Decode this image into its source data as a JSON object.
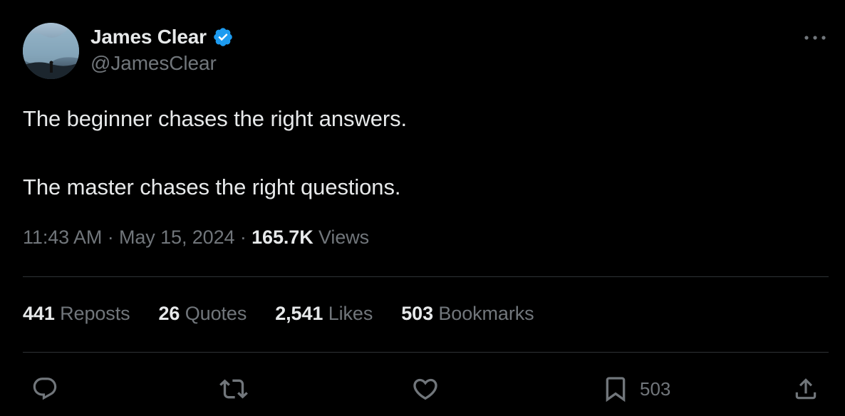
{
  "author": {
    "display_name": "James Clear",
    "handle": "@JamesClear",
    "verified": true
  },
  "tweet": {
    "lines": [
      "The beginner chases the right answers.",
      "The master chases the right questions."
    ],
    "time": "11:43 AM",
    "separator": "·",
    "date": "May 15, 2024",
    "views_count": "165.7K",
    "views_label": "Views"
  },
  "stats": [
    {
      "count": "441",
      "label": "Reposts"
    },
    {
      "count": "26",
      "label": "Quotes"
    },
    {
      "count": "2,541",
      "label": "Likes"
    },
    {
      "count": "503",
      "label": "Bookmarks"
    }
  ],
  "actions": {
    "bookmark_count": "503"
  },
  "icons": {
    "more": "more-horizontal-icon",
    "verified": "verified-badge-icon",
    "reply": "reply-icon",
    "repost": "repost-icon",
    "like": "heart-icon",
    "bookmark": "bookmark-icon",
    "share": "share-icon"
  },
  "colors": {
    "background": "#000000",
    "text_primary": "#e7e9ea",
    "text_secondary": "#71767b",
    "verified_blue": "#1d9bf0",
    "divider": "#2f3336"
  }
}
